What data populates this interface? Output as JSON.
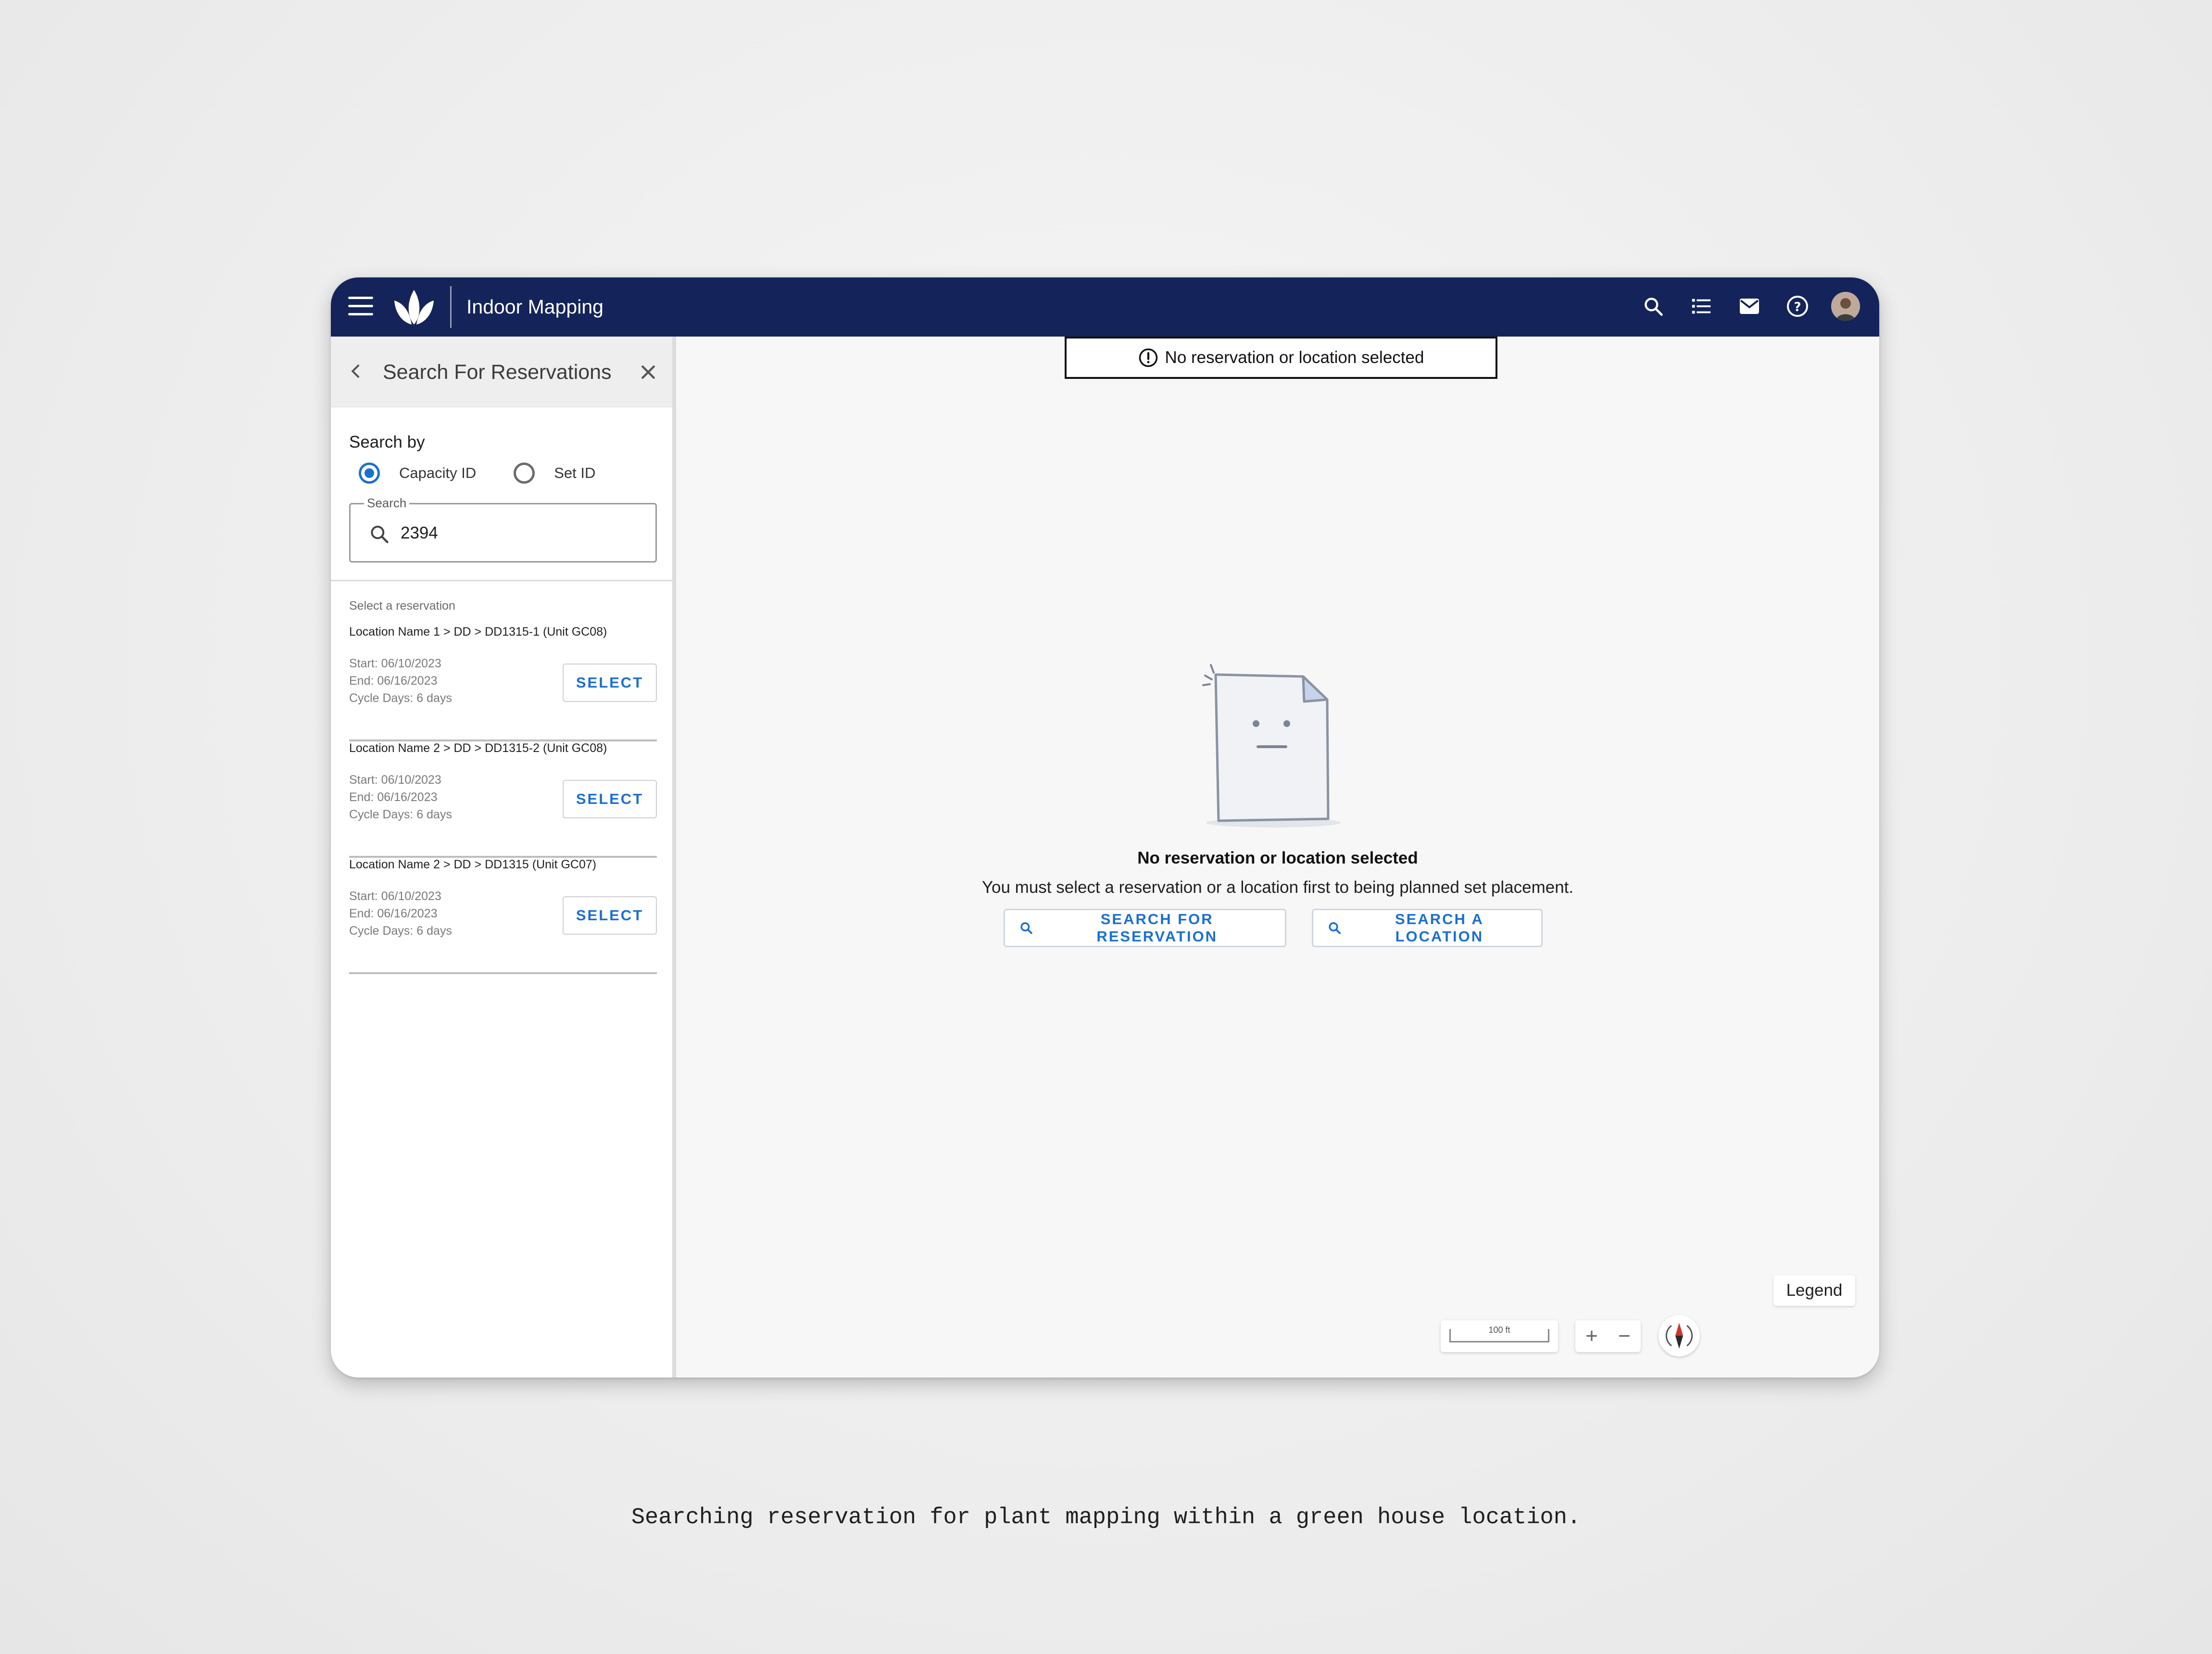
{
  "app": {
    "title": "Indoor Mapping"
  },
  "topbar": {
    "icons": [
      "search-icon",
      "list-icon",
      "mail-icon",
      "help-icon",
      "user-avatar"
    ]
  },
  "sidebar": {
    "title": "Search For Reservations",
    "search_by_label": "Search by",
    "radio_options": [
      {
        "label": "Capacity ID",
        "selected": true
      },
      {
        "label": "Set ID",
        "selected": false
      }
    ],
    "search": {
      "legend": "Search",
      "value": "2394"
    },
    "select_label": "Select a reservation",
    "reservations": [
      {
        "title": "Location Name 1 > DD > DD1315-1 (Unit GC08)",
        "start": "Start: 06/10/2023",
        "end": "End: 06/16/2023",
        "cycle": "Cycle Days: 6 days",
        "button": "SELECT"
      },
      {
        "title": "Location Name 2 > DD > DD1315-2 (Unit GC08)",
        "start": "Start: 06/10/2023",
        "end": "End: 06/16/2023",
        "cycle": "Cycle Days: 6 days",
        "button": "SELECT"
      },
      {
        "title": "Location Name 2 > DD > DD1315 (Unit GC07)",
        "start": "Start: 06/10/2023",
        "end": "End: 06/16/2023",
        "cycle": "Cycle Days: 6 days",
        "button": "SELECT"
      }
    ]
  },
  "main": {
    "banner": "No reservation or location selected",
    "empty_title": "No reservation or location selected",
    "empty_desc": "You must select a reservation or a location first to being planned set placement.",
    "btn_search_reservation": "SEARCH FOR RESERVATION",
    "btn_search_location": "SEARCH A LOCATION",
    "legend": "Legend",
    "scale": "100 ft",
    "zoom_in": "+",
    "zoom_out": "−"
  },
  "colors": {
    "topbar": "#14245a",
    "accent": "#1b6fd1"
  },
  "caption": "Searching reservation for plant mapping within a green house location."
}
